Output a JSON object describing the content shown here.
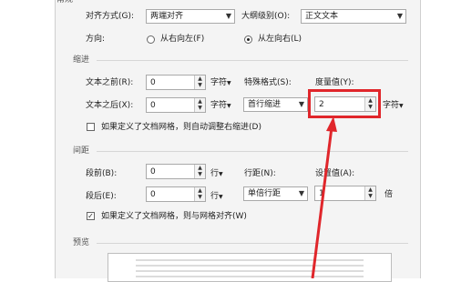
{
  "general": {
    "partial_header": "常规",
    "alignment_label": "对齐方式(G):",
    "alignment_value": "两端对齐",
    "outline_label": "大纲级别(O):",
    "outline_value": "正文文本",
    "direction_label": "方向:",
    "direction_rtl": "从右向左(F)",
    "direction_ltr": "从左向右(L)",
    "direction_selected": "从左向右(L)"
  },
  "indent": {
    "header": "缩进",
    "before_text_label": "文本之前(R):",
    "before_text_value": "0",
    "before_text_unit": "字符",
    "after_text_label": "文本之后(X):",
    "after_text_value": "0",
    "after_text_unit": "字符",
    "special_label": "特殊格式(S):",
    "special_value": "首行缩进",
    "measure_label": "度量值(Y):",
    "measure_value": "2",
    "measure_unit": "字符",
    "grid_checkbox_label": "如果定义了文档网格，则自动调整右缩进(D)",
    "grid_checkbox_checked": false
  },
  "spacing": {
    "header": "间距",
    "before_label": "段前(B):",
    "before_value": "0",
    "before_unit": "行",
    "after_label": "段后(E):",
    "after_value": "0",
    "after_unit": "行",
    "line_spacing_label": "行距(N):",
    "line_spacing_value": "单倍行距",
    "setting_label": "设置值(A):",
    "setting_value": "1",
    "setting_unit": "倍",
    "grid_checkbox_label": "如果定义了文档网格，则与网格对齐(W)",
    "grid_checkbox_checked": true
  },
  "preview": {
    "header": "预览"
  },
  "icons": {
    "dropdown": "chevron-down-icon",
    "spin_up": "spin-up-icon",
    "spin_down": "spin-down-icon",
    "unit_menu": "unit-menu-icon"
  },
  "colors": {
    "highlight": "#e0262b",
    "dialog_bg": "#f4f4f4"
  }
}
